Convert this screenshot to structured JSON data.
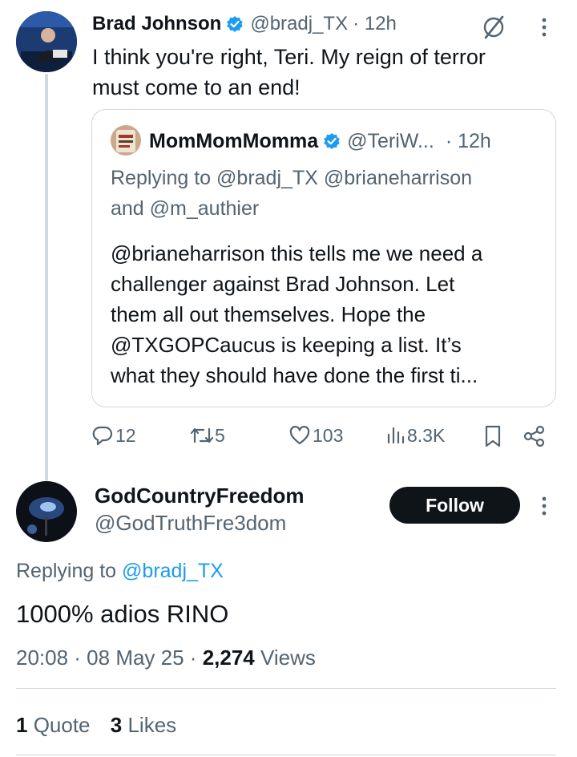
{
  "tweet": {
    "author_name": "Brad Johnson",
    "handle": "@bradj_TX",
    "time": "· 12h",
    "text_line1": "I think you're right, Teri. My reign of terror",
    "text_line2": "must come to an end!"
  },
  "quote": {
    "author_name": "MomMomMomma",
    "handle": "@TeriW...",
    "time": "· 12h",
    "replying_prefix": "Replying to ",
    "replying_to1": "@bradj_TX",
    "replying_to2": "@brianeharrison",
    "replying_and": "and ",
    "replying_to3": "@m_authier",
    "text_lines": [
      "@brianeharrison this tells me we need a",
      "challenger against Brad Johnson. Let",
      "them all out themselves. Hope the",
      "@TXGOPCaucus is keeping a list. It’s",
      "what they should have done the first ti..."
    ]
  },
  "actions": {
    "replies": "12",
    "reposts": "5",
    "likes": "103",
    "views": "8.3K"
  },
  "reply": {
    "author_name": "GodCountryFreedom",
    "handle": "@GodTruthFre3dom",
    "follow_label": "Follow",
    "replying_prefix": "Replying to ",
    "replying_to": "@bradj_TX",
    "text": "1000% adios RINO",
    "time": "20:08 · 08 May 25 · ",
    "views_count": "2,274",
    "views_label": " Views",
    "quotes_count": "1",
    "quotes_label": " Quote",
    "likes_count": "3",
    "likes_label": " Likes"
  },
  "colors": {
    "accent": "#1d9bf0",
    "verified": "#1d9bf0",
    "text_secondary": "#536471",
    "follow_bg": "#0f1419"
  },
  "icons": {
    "verified": "verified-badge-icon",
    "grok": "grok-icon",
    "more": "more-icon",
    "reply": "reply-icon",
    "repost": "repost-icon",
    "like": "like-icon",
    "views": "views-icon",
    "bookmark": "bookmark-icon",
    "share": "share-icon"
  }
}
